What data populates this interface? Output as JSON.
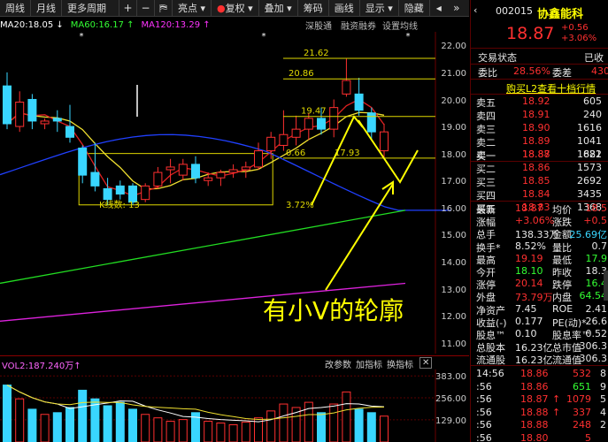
{
  "toolbar": {
    "items": [
      "周线",
      "月线",
      "更多周期"
    ],
    "icons": {
      "plus": "+",
      "minus": "−",
      "flag": "⛿"
    },
    "tools": [
      "亮点",
      "复权",
      "叠加",
      "筹码",
      "画线",
      "显示",
      "隐藏"
    ],
    "right_icons": [
      "◂",
      "»"
    ]
  },
  "ma_legend": {
    "ma20": "MA20:18.05 ↓",
    "ma60": "MA60:16.17 ↑",
    "ma120": "MA120:13.29 ↑",
    "links": [
      "深股通",
      "融资融券",
      "设置均线"
    ]
  },
  "chart_data": {
    "type": "candlestick",
    "y_ticks": [
      "22.00",
      "21.00",
      "20.00",
      "19.00",
      "18.00",
      "17.00",
      "16.00",
      "15.00",
      "14.00",
      "13.00",
      "12.00",
      "11.00"
    ],
    "ylim": [
      10.7,
      22.6
    ],
    "markers": [
      "21.62",
      "20.86",
      "19.47",
      "0.66",
      "17.93",
      "3.72%",
      "K线数: 13"
    ],
    "annotation": "有小V的轮廓",
    "candles": [
      {
        "o": 20.6,
        "h": 21.1,
        "l": 19.0,
        "c": 19.2,
        "up": false
      },
      {
        "o": 19.1,
        "h": 20.4,
        "l": 18.9,
        "c": 20.0,
        "up": true
      },
      {
        "o": 20.1,
        "h": 20.3,
        "l": 19.0,
        "c": 19.3,
        "up": false
      },
      {
        "o": 19.2,
        "h": 19.4,
        "l": 19.0,
        "c": 19.3,
        "up": true
      },
      {
        "o": 19.4,
        "h": 19.7,
        "l": 18.9,
        "c": 19.3,
        "up": false
      },
      {
        "o": 19.1,
        "h": 19.9,
        "l": 18.5,
        "c": 18.7,
        "up": false
      },
      {
        "o": 18.3,
        "h": 18.4,
        "l": 17.0,
        "c": 17.3,
        "up": false
      },
      {
        "o": 17.4,
        "h": 18.5,
        "l": 16.7,
        "c": 16.9,
        "up": false
      },
      {
        "o": 16.8,
        "h": 17.2,
        "l": 16.2,
        "c": 16.4,
        "up": false
      },
      {
        "o": 16.6,
        "h": 17.1,
        "l": 16.4,
        "c": 16.9,
        "up": false
      },
      {
        "o": 16.9,
        "h": 17.0,
        "l": 16.2,
        "c": 16.3,
        "up": false
      },
      {
        "o": 16.4,
        "h": 17.0,
        "l": 16.3,
        "c": 16.9,
        "up": true
      },
      {
        "o": 16.9,
        "h": 17.6,
        "l": 16.8,
        "c": 17.4,
        "up": true
      },
      {
        "o": 17.5,
        "h": 17.9,
        "l": 17.0,
        "c": 17.6,
        "up": true
      },
      {
        "o": 17.3,
        "h": 17.9,
        "l": 17.1,
        "c": 17.7,
        "up": true
      },
      {
        "o": 17.7,
        "h": 18.0,
        "l": 17.0,
        "c": 17.2,
        "up": false
      },
      {
        "o": 17.1,
        "h": 17.4,
        "l": 16.9,
        "c": 17.2,
        "up": true
      },
      {
        "o": 17.2,
        "h": 17.5,
        "l": 16.9,
        "c": 17.4,
        "up": true
      },
      {
        "o": 17.4,
        "h": 17.7,
        "l": 17.2,
        "c": 17.5,
        "up": true
      },
      {
        "o": 17.5,
        "h": 17.8,
        "l": 17.2,
        "c": 17.6,
        "up": true
      },
      {
        "o": 17.6,
        "h": 18.5,
        "l": 17.5,
        "c": 18.2,
        "up": true
      },
      {
        "o": 18.2,
        "h": 18.9,
        "l": 17.9,
        "c": 18.7,
        "up": true
      },
      {
        "o": 18.4,
        "h": 19.7,
        "l": 18.2,
        "c": 18.8,
        "up": true
      },
      {
        "o": 18.7,
        "h": 19.5,
        "l": 18.4,
        "c": 19.0,
        "up": true
      },
      {
        "o": 19.0,
        "h": 19.6,
        "l": 18.6,
        "c": 19.4,
        "up": true
      },
      {
        "o": 19.4,
        "h": 19.8,
        "l": 18.8,
        "c": 19.0,
        "up": false
      },
      {
        "o": 19.0,
        "h": 20.1,
        "l": 18.7,
        "c": 19.8,
        "up": true
      },
      {
        "o": 20.3,
        "h": 21.6,
        "l": 20.2,
        "c": 20.8,
        "up": true
      },
      {
        "o": 20.3,
        "h": 20.9,
        "l": 19.5,
        "c": 19.7,
        "up": false
      },
      {
        "o": 19.6,
        "h": 19.8,
        "l": 18.6,
        "c": 18.9,
        "up": false
      },
      {
        "o": 18.2,
        "h": 19.2,
        "l": 17.9,
        "c": 18.9,
        "up": true
      }
    ],
    "vol_ticks": [
      "383.00",
      "256.00",
      "129.00"
    ],
    "vol_ylim": [
      0,
      420
    ],
    "volumes": [
      330,
      250,
      190,
      160,
      170,
      200,
      300,
      250,
      210,
      230,
      190,
      160,
      140,
      120,
      130,
      170,
      120,
      110,
      100,
      115,
      140,
      180,
      220,
      200,
      230,
      170,
      220,
      290,
      190,
      170,
      150
    ]
  },
  "volume_header": {
    "label": "VOL2:187.240万↑",
    "buttons": [
      "改参数",
      "加指标",
      "换指标"
    ]
  },
  "stock": {
    "code": "002015",
    "name": "协鑫能科",
    "price": "18.87",
    "change": "+0.56",
    "change_pct": "+3.06%",
    "status_label": "交易状态",
    "status_value": "已收",
    "wei_bi_label": "委比",
    "wei_bi_value": "28.56%",
    "wei_cha_label": "委差",
    "wei_cha_value": "430",
    "promo": "购买L2查看十档行情"
  },
  "order_book": {
    "asks": [
      {
        "label": "卖五",
        "price": "18.92",
        "vol": "605"
      },
      {
        "label": "卖四",
        "price": "18.91",
        "vol": "240"
      },
      {
        "label": "卖三",
        "price": "18.90",
        "vol": "1616"
      },
      {
        "label": "卖二",
        "price": "18.89",
        "vol": "1041"
      },
      {
        "label": "卖一",
        "price": "18.88",
        "vol": "1882"
      }
    ],
    "bids": [
      {
        "label": "买一",
        "price": "18.87",
        "vol": "621"
      },
      {
        "label": "买二",
        "price": "18.86",
        "vol": "1573"
      },
      {
        "label": "买三",
        "price": "18.85",
        "vol": "2692"
      },
      {
        "label": "买四",
        "price": "18.84",
        "vol": "3435"
      },
      {
        "label": "买五",
        "price": "18.83",
        "vol": "1368"
      }
    ]
  },
  "stats": [
    {
      "l1": "最新",
      "v1": "18.87",
      "c1": "red",
      "l2": "均价",
      "v2": "18.5",
      "c2": "red"
    },
    {
      "l1": "涨幅",
      "v1": "+3.06%",
      "c1": "red",
      "l2": "涨跌",
      "v2": "+0.5",
      "c2": "red"
    },
    {
      "l1": "总手",
      "v1": "138.33万",
      "c1": "white",
      "l2": "金额",
      "v2": "25.69亿",
      "c2": "cyan"
    },
    {
      "l1": "换手*",
      "v1": "8.52%",
      "c1": "white",
      "l2": "量比",
      "v2": "0.7",
      "c2": "white"
    },
    {
      "l1": "最高",
      "v1": "19.19",
      "c1": "red",
      "l2": "最低",
      "v2": "17.9",
      "c2": "green"
    },
    {
      "l1": "今开",
      "v1": "18.10",
      "c1": "green",
      "l2": "昨收",
      "v2": "18.3",
      "c2": "white"
    },
    {
      "l1": "涨停",
      "v1": "20.14",
      "c1": "red",
      "l2": "跌停",
      "v2": "16.4",
      "c2": "green"
    },
    {
      "l1": "外盘",
      "v1": "73.79万",
      "c1": "red",
      "l2": "内盘",
      "v2": "64.54",
      "c2": "green"
    },
    {
      "l1": "净资产",
      "v1": "7.45",
      "c1": "white",
      "l2": "ROE",
      "v2": "2.41",
      "c2": "white"
    },
    {
      "l1": "收益(-)",
      "v1": "0.177",
      "c1": "white",
      "l2": "PE(动)*",
      "v2": "26.6",
      "c2": "white"
    },
    {
      "l1": "股息™",
      "v1": "0.10",
      "c1": "white",
      "l2": "股息率™",
      "v2": "0.52",
      "c2": "white"
    },
    {
      "l1": "总股本",
      "v1": "16.23亿",
      "c1": "white",
      "l2": "总市值",
      "v2": "306.3",
      "c2": "white"
    },
    {
      "l1": "流通股",
      "v1": "16.23亿",
      "c1": "white",
      "l2": "流通值",
      "v2": "306.3",
      "c2": "white"
    }
  ],
  "ticks": [
    {
      "time": "14:56",
      "price": "18.86",
      "arrow": "",
      "vol": "532",
      "vc": "red",
      "n": "8"
    },
    {
      "time": ":56",
      "price": "18.86",
      "arrow": "",
      "vol": "651",
      "vc": "green",
      "n": "9"
    },
    {
      "time": ":56",
      "price": "18.87",
      "arrow": "↑",
      "vol": "1079",
      "vc": "red",
      "n": "5"
    },
    {
      "time": ":56",
      "price": "18.88",
      "arrow": "↑",
      "vol": "337",
      "vc": "red",
      "n": "4"
    },
    {
      "time": ":56",
      "price": "18.88",
      "arrow": "",
      "vol": "248",
      "vc": "red",
      "n": "2"
    },
    {
      "time": ":56",
      "price": "18.80",
      "arrow": "",
      "vol": "5",
      "vc": "red",
      "n": ""
    }
  ]
}
